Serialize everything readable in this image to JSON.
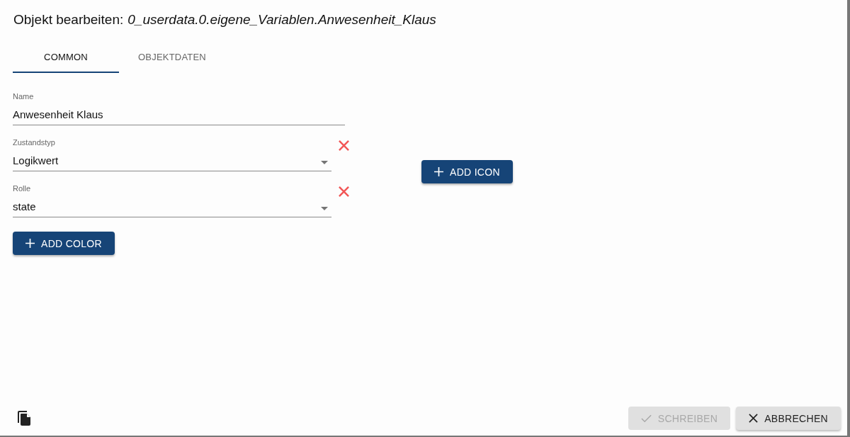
{
  "dialog": {
    "title": "Objekt bearbeiten:",
    "object_id": "0_userdata.0.eigene_Variablen.Anwesenheit_Klaus"
  },
  "tabs": [
    {
      "label": "COMMON",
      "selected": true
    },
    {
      "label": "OBJEKTDATEN",
      "selected": false
    }
  ],
  "fields": [
    {
      "kind": "text",
      "label": "Name",
      "value": "Anwesenheit Klaus",
      "removable": false
    },
    {
      "kind": "select",
      "label": "Zustandstyp",
      "value": "Logikwert",
      "removable": true
    },
    {
      "kind": "select",
      "label": "Rolle",
      "value": "state",
      "removable": true
    }
  ],
  "add_color_button": {
    "label": "ADD COLOR"
  },
  "add_icon_button": {
    "label": "ADD ICON"
  },
  "footer_buttons": [
    {
      "kind": "check",
      "label": "SCHREIBEN",
      "disabled": true
    },
    {
      "kind": "close",
      "label": "ABBRECHEN",
      "disabled": false
    }
  ]
}
